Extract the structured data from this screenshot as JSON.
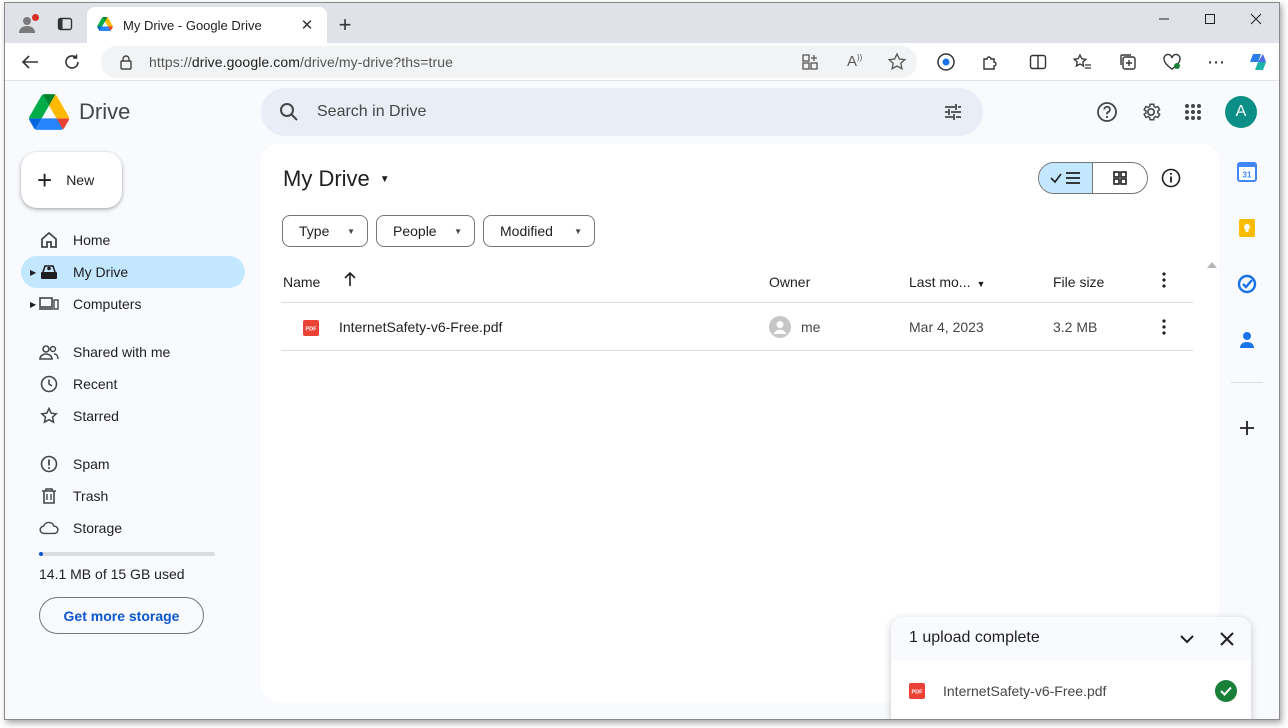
{
  "browser": {
    "tab_title": "My Drive - Google Drive",
    "url_scheme": "https://",
    "url_host": "drive.google.com",
    "url_path": "/drive/my-drive?ths=true"
  },
  "app": {
    "logo_text": "Drive",
    "search_placeholder": "Search in Drive",
    "avatar_letter": "A"
  },
  "sidebar": {
    "new_label": "New",
    "items": [
      {
        "label": "Home"
      },
      {
        "label": "My Drive"
      },
      {
        "label": "Computers"
      },
      {
        "label": "Shared with me"
      },
      {
        "label": "Recent"
      },
      {
        "label": "Starred"
      },
      {
        "label": "Spam"
      },
      {
        "label": "Trash"
      },
      {
        "label": "Storage"
      }
    ],
    "storage_used_fraction": 0.01,
    "storage_text": "14.1 MB of 15 GB used",
    "get_storage_label": "Get more storage"
  },
  "main": {
    "title": "My Drive",
    "filters": [
      "Type",
      "People",
      "Modified"
    ],
    "columns": {
      "name": "Name",
      "owner": "Owner",
      "modified": "Last mo...",
      "size": "File size"
    },
    "files": [
      {
        "name": "InternetSafety-v6-Free.pdf",
        "owner": "me",
        "modified": "Mar 4, 2023",
        "size": "3.2 MB"
      }
    ]
  },
  "upload_panel": {
    "title": "1 upload complete",
    "file_name": "InternetSafety-v6-Free.pdf",
    "pdf_label": "PDF"
  },
  "side_panel": {
    "calendar_day": "31"
  },
  "colors": {
    "accent_blue": "#0b57d0",
    "active_nav": "#c2e7ff",
    "avatar": "#0b8f87",
    "success": "#188038",
    "pdf_red": "#ea4335"
  }
}
